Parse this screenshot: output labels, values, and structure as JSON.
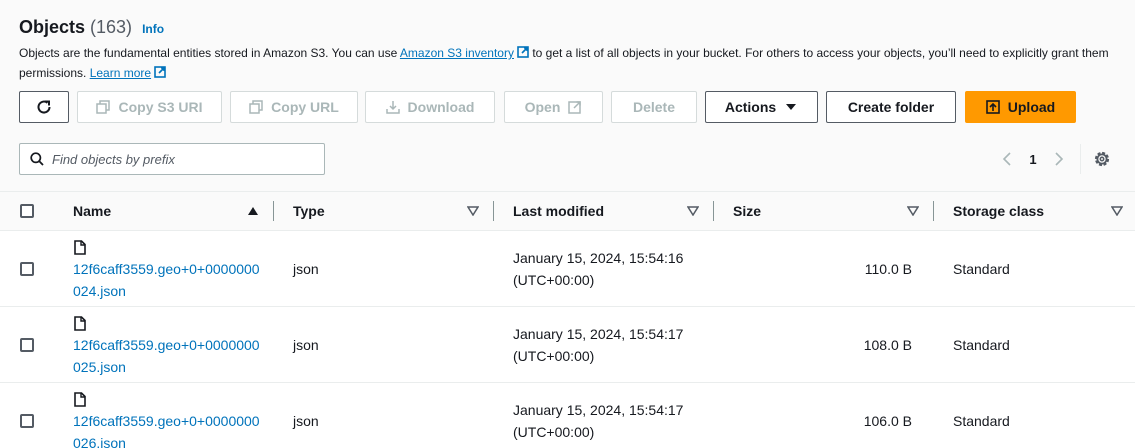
{
  "header": {
    "title": "Objects",
    "count": "(163)",
    "info_link": "Info",
    "desc_part1": "Objects are the fundamental entities stored in Amazon S3. You can use ",
    "desc_link1": "Amazon S3 inventory",
    "desc_part2": " to get a list of all objects in your bucket. For others to access your objects, you’ll need to explicitly grant them permissions. ",
    "desc_link2": "Learn more"
  },
  "toolbar": {
    "copy_s3_uri": "Copy S3 URI",
    "copy_url": "Copy URL",
    "download": "Download",
    "open": "Open",
    "delete": "Delete",
    "actions": "Actions",
    "create_folder": "Create folder",
    "upload": "Upload"
  },
  "search": {
    "placeholder": "Find objects by prefix",
    "value": ""
  },
  "pagination": {
    "current_page": "1"
  },
  "table": {
    "columns": [
      "Name",
      "Type",
      "Last modified",
      "Size",
      "Storage class"
    ],
    "rows": [
      {
        "name": "12f6caff3559.geo+0+0000000024.json",
        "type": "json",
        "last_modified_date": "January 15, 2024, 15:54:16",
        "last_modified_tz": "(UTC+00:00)",
        "size": "110.0 B",
        "storage_class": "Standard"
      },
      {
        "name": "12f6caff3559.geo+0+0000000025.json",
        "type": "json",
        "last_modified_date": "January 15, 2024, 15:54:17",
        "last_modified_tz": "(UTC+00:00)",
        "size": "108.0 B",
        "storage_class": "Standard"
      },
      {
        "name": "12f6caff3559.geo+0+0000000026.json",
        "type": "json",
        "last_modified_date": "January 15, 2024, 15:54:17",
        "last_modified_tz": "(UTC+00:00)",
        "size": "106.0 B",
        "storage_class": "Standard"
      }
    ]
  },
  "icons": {
    "refresh": "refresh-icon",
    "copy": "copy-icon",
    "download": "download-icon",
    "external": "external-link-icon",
    "caret": "caret-down-icon",
    "upload": "upload-icon",
    "search": "search-icon",
    "settings": "gear-icon",
    "file": "file-icon"
  },
  "colors": {
    "link": "#0073bb",
    "primary": "#ff9900",
    "disabled": "#aab7b8"
  }
}
